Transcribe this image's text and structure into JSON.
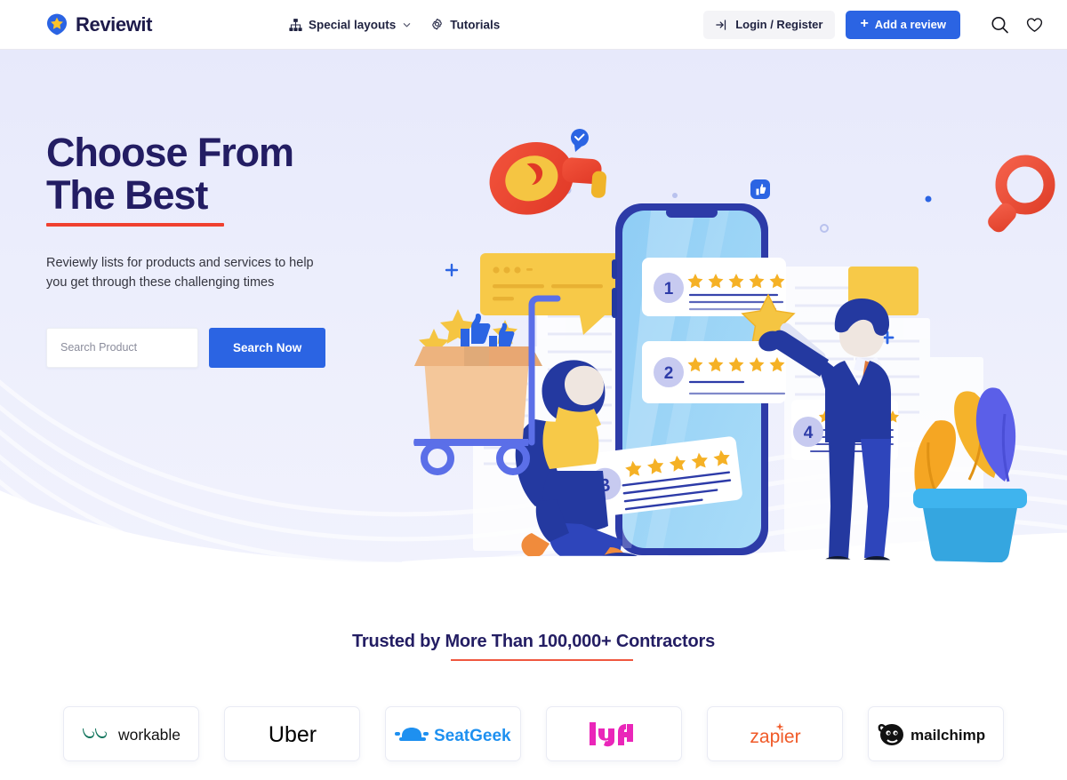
{
  "header": {
    "brand": {
      "name": "Reviewit",
      "icon": "star-pin-logo-icon"
    },
    "nav": [
      {
        "label": "Special layouts",
        "icon": "sitemap-icon",
        "has_caret": true
      },
      {
        "label": "Tutorials",
        "icon": "gear-icon",
        "has_caret": false
      }
    ],
    "login_label": "Login / Register",
    "add_review_label": "Add a review",
    "add_review_plus": "+",
    "icons": [
      "search-icon",
      "heart-icon"
    ],
    "accent_blue": "#2b64e3",
    "login_bg": "#f4f4f7"
  },
  "hero": {
    "title": "Choose From\nThe Best",
    "title_color": "#231d63",
    "rule_color": "#f0402f",
    "subtitle": "Reviewly lists for products and services to help you get through these challenging times",
    "search_placeholder": "Search Product",
    "search_value": "",
    "search_button_label": "Search Now",
    "background": "#eceefc",
    "illustration": {
      "name": "review-app-illustration",
      "review_cards": [
        {
          "number": "1",
          "stars": 5
        },
        {
          "number": "2",
          "stars": 5
        },
        {
          "number": "3",
          "stars": 5
        },
        {
          "number": "4",
          "stars": 5
        }
      ],
      "elements": [
        "phone-mockup",
        "megaphone-icon",
        "magnifier-icon",
        "speech-bubble",
        "shopping-cart-box",
        "person-kneeling",
        "person-standing",
        "potted-plant",
        "city-buildings",
        "thumbs-up-icon"
      ]
    }
  },
  "trusted": {
    "heading": "Trusted by More Than 100,000+ Contractors",
    "underline_color": "#f0573f",
    "logos": [
      {
        "name": "workable",
        "label": "workable",
        "color": "#11745c"
      },
      {
        "name": "uber",
        "label": "Uber",
        "color": "#000000"
      },
      {
        "name": "seatgeek",
        "label": "SeatGeek",
        "color": "#1e90f0"
      },
      {
        "name": "lyft",
        "label": "lyft",
        "color": "#ea26b9"
      },
      {
        "name": "zapier",
        "label": "zapier",
        "color": "#f05a28"
      },
      {
        "name": "mailchimp",
        "label": "mailchimp",
        "color": "#0f0f0f"
      }
    ]
  }
}
